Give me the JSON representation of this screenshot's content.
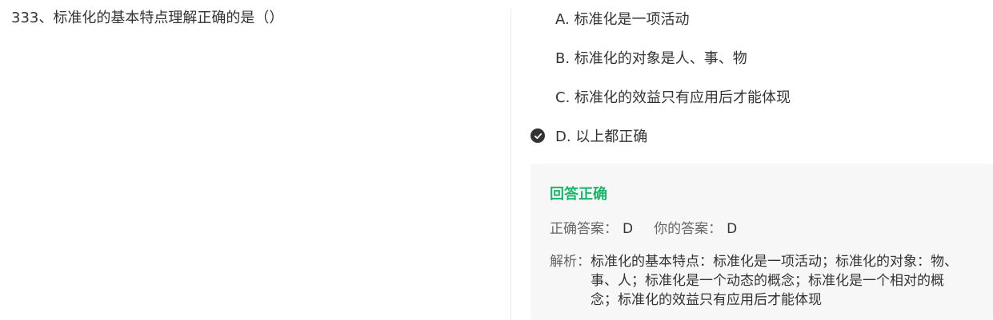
{
  "question": {
    "text": "333、标准化的基本特点理解正确的是（）"
  },
  "options": [
    {
      "label": "A. 标准化是一项活动",
      "selected": false
    },
    {
      "label": "B. 标准化的对象是人、事、物",
      "selected": false
    },
    {
      "label": "C. 标准化的效益只有应用后才能体现",
      "selected": false
    },
    {
      "label": "D. 以上都正确",
      "selected": true
    }
  ],
  "result": {
    "status": "回答正确",
    "correct_label": "正确答案：",
    "correct_value": "D",
    "your_label": "你的答案：",
    "your_value": "D",
    "analysis_label": "解析：",
    "analysis_text": "标准化的基本特点：标准化是一项活动；标准化的对象：物、事、人；标准化是一个动态的概念；标准化是一个相对的概念；标准化的效益只有应用后才能体现"
  },
  "colors": {
    "correct_green": "#1ab56b",
    "text": "#333333",
    "muted": "#666666",
    "panel_bg": "#f7f7f7"
  },
  "icons": {
    "selected_option": "check-circle-icon"
  }
}
